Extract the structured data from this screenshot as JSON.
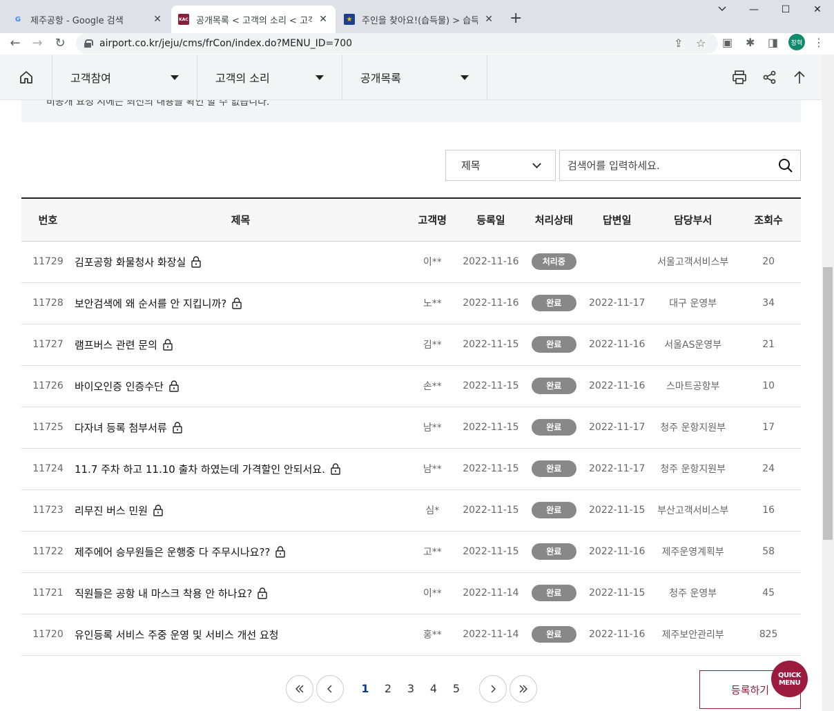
{
  "browser": {
    "tabs": [
      {
        "title": "제주공항 - Google 검색",
        "active": false
      },
      {
        "title": "공개목록 < 고객의 소리 < 고객참여",
        "active": true
      },
      {
        "title": "주인을 찾아요!(습득물) > 습득물",
        "active": false
      }
    ],
    "url": "airport.co.kr/jeju/cms/frCon/index.do?MENU_ID=700",
    "profile_label": "창혁"
  },
  "nav": {
    "menus": [
      "고객참여",
      "고객의 소리",
      "공개목록"
    ]
  },
  "notice_text": "비공개 요청 시에는 최신의 내용을 확인 할 수 없습니다.",
  "search": {
    "field": "제목",
    "placeholder": "검색어를 입력하세요."
  },
  "table": {
    "headers": [
      "번호",
      "제목",
      "고객명",
      "등록일",
      "처리상태",
      "답변일",
      "담당부서",
      "조회수"
    ],
    "rows": [
      {
        "no": "11729",
        "title": "김포공항 화물청사 화장실",
        "locked": true,
        "name": "이**",
        "date": "2022-11-16",
        "status": "처리중",
        "answered": "",
        "dept": "서울고객서비스부",
        "views": "20"
      },
      {
        "no": "11728",
        "title": "보안검색에 왜 순서를 안 지킵니까?",
        "locked": true,
        "name": "노**",
        "date": "2022-11-16",
        "status": "완료",
        "answered": "2022-11-17",
        "dept": "대구 운영부",
        "views": "34"
      },
      {
        "no": "11727",
        "title": "램프버스 관련 문의",
        "locked": true,
        "name": "김**",
        "date": "2022-11-15",
        "status": "완료",
        "answered": "2022-11-16",
        "dept": "서울AS운영부",
        "views": "21"
      },
      {
        "no": "11726",
        "title": "바이오인증 인증수단",
        "locked": true,
        "name": "손**",
        "date": "2022-11-15",
        "status": "완료",
        "answered": "2022-11-16",
        "dept": "스마트공항부",
        "views": "10"
      },
      {
        "no": "11725",
        "title": "다자녀 등록 첨부서류",
        "locked": true,
        "name": "남**",
        "date": "2022-11-15",
        "status": "완료",
        "answered": "2022-11-17",
        "dept": "청주 운항지원부",
        "views": "17"
      },
      {
        "no": "11724",
        "title": "11.7 주차 하고 11.10 출차 하였는데 가격할인 안되서요.",
        "locked": true,
        "name": "남**",
        "date": "2022-11-15",
        "status": "완료",
        "answered": "2022-11-17",
        "dept": "청주 운항지원부",
        "views": "24"
      },
      {
        "no": "11723",
        "title": "리무진 버스 민원",
        "locked": true,
        "name": "심*",
        "date": "2022-11-15",
        "status": "완료",
        "answered": "2022-11-15",
        "dept": "부산고객서비스부",
        "views": "16"
      },
      {
        "no": "11722",
        "title": "제주에어 승무원들은 운행중 다 주무시나요??",
        "locked": true,
        "name": "고**",
        "date": "2022-11-15",
        "status": "완료",
        "answered": "2022-11-16",
        "dept": "제주운영계획부",
        "views": "58"
      },
      {
        "no": "11721",
        "title": "직원들은 공항 내 마스크 착용 안 하나요?",
        "locked": true,
        "name": "이**",
        "date": "2022-11-14",
        "status": "완료",
        "answered": "2022-11-15",
        "dept": "청주 운영부",
        "views": "45"
      },
      {
        "no": "11720",
        "title": "유인등록 서비스 주중 운영 및 서비스 개선 요청",
        "locked": false,
        "name": "홍**",
        "date": "2022-11-14",
        "status": "완료",
        "answered": "2022-11-16",
        "dept": "제주보안관리부",
        "views": "825"
      }
    ]
  },
  "pagination": {
    "pages": [
      "1",
      "2",
      "3",
      "4",
      "5"
    ],
    "current": "1"
  },
  "register_label": "등록하기",
  "quick_menu_label": "QUICK MENU",
  "colors": {
    "brand": "#9c1a3e",
    "badge": "#888888",
    "current_page": "#0e3a84"
  }
}
